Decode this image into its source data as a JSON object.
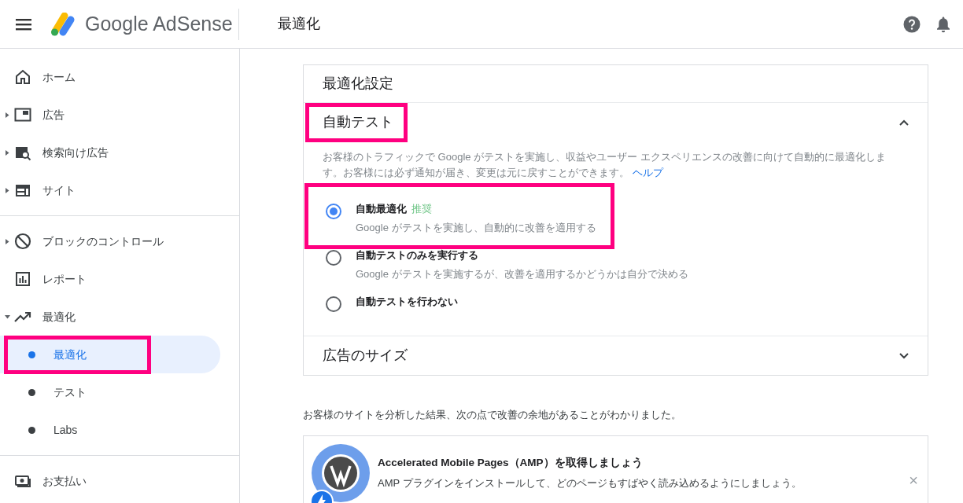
{
  "header": {
    "product": "Google AdSense",
    "page_title": "最適化"
  },
  "sidebar": {
    "groups": [
      [
        {
          "label": "ホーム",
          "expandable": false
        },
        {
          "label": "広告",
          "expandable": true,
          "expanded": false
        },
        {
          "label": "検索向け広告",
          "expandable": true,
          "expanded": false
        },
        {
          "label": "サイト",
          "expandable": true,
          "expanded": false
        }
      ],
      [
        {
          "label": "ブロックのコントロール",
          "expandable": true,
          "expanded": false
        },
        {
          "label": "レポート",
          "expandable": false
        },
        {
          "label": "最適化",
          "expandable": true,
          "expanded": true,
          "children": [
            {
              "label": "最適化",
              "selected": true,
              "highlighted": true
            },
            {
              "label": "テスト",
              "selected": false,
              "highlighted": false
            },
            {
              "label": "Labs",
              "selected": false,
              "highlighted": false
            }
          ]
        }
      ],
      [
        {
          "label": "お支払い",
          "expandable": false
        }
      ]
    ]
  },
  "settings_card": {
    "title": "最適化設定",
    "sections": [
      {
        "title": "自動テスト",
        "expanded": true,
        "highlighted": true,
        "description": "お客様のトラフィックで Google がテストを実施し、収益やユーザー エクスペリエンスの改善に向けて自動的に最適化します。お客様には必ず通知が届き、変更は元に戻すことができます。",
        "help_link": "ヘルプ",
        "options": [
          {
            "label": "自動最適化",
            "badge": "推奨",
            "sub": "Google がテストを実施し、自動的に改善を適用する",
            "selected": true,
            "highlighted": true
          },
          {
            "label": "自動テストのみを実行する",
            "sub": "Google がテストを実施するが、改善を適用するかどうかは自分で決める",
            "selected": false,
            "highlighted": false
          },
          {
            "label": "自動テストを行わない",
            "selected": false,
            "highlighted": false
          }
        ]
      },
      {
        "title": "広告のサイズ",
        "expanded": false,
        "highlighted": false
      }
    ]
  },
  "analysis_text": "お客様のサイトを分析した結果、次の点で改善の余地があることがわかりました。",
  "recommendation": {
    "title": "Accelerated Mobile Pages（AMP）を取得しましょう",
    "body": "AMP プラグインをインストールして、どのページもすばやく読み込めるようにしましょう。",
    "close": "×"
  }
}
